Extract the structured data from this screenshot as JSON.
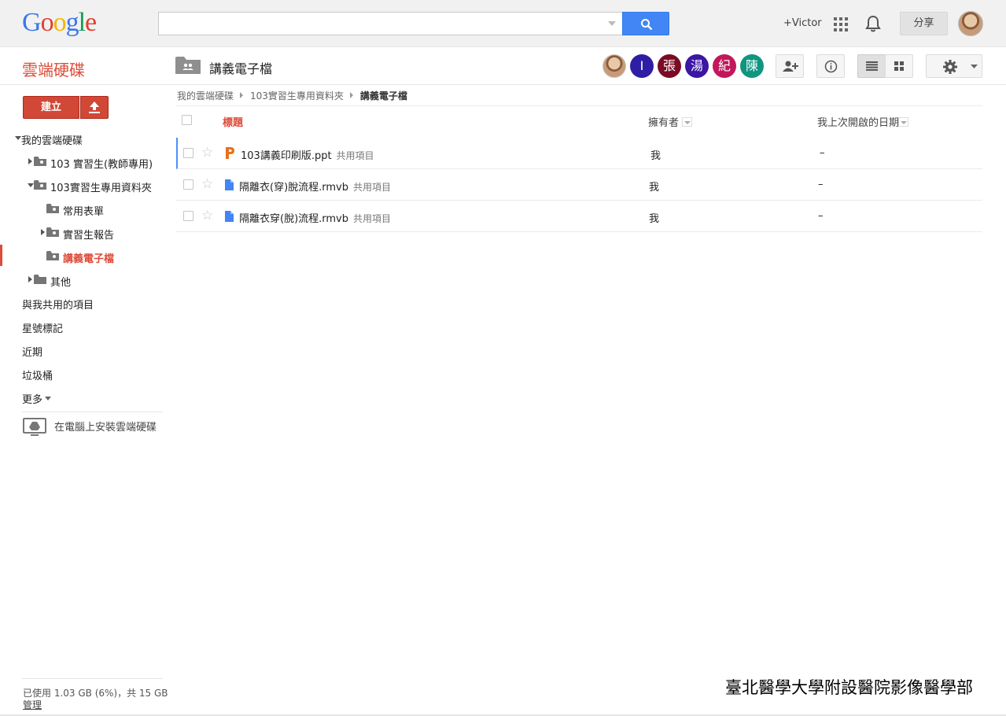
{
  "header": {
    "logo_text": "Google",
    "search": {
      "placeholder": "",
      "value": ""
    },
    "user_link": "+Victor",
    "share_label": "分享"
  },
  "subheader": {
    "app_name": "雲端硬碟",
    "folder_title": "講義電子檔",
    "shared_with": [
      "I",
      "張",
      "湯",
      "紀",
      "陳"
    ]
  },
  "sidebar": {
    "create_label": "建立",
    "tree": {
      "root": "我的雲端硬碟",
      "items": [
        {
          "label": "103 實習生(教師專用)"
        },
        {
          "label": "103實習生專用資料夾"
        },
        {
          "label": "常用表單"
        },
        {
          "label": "實習生報告"
        },
        {
          "label": "講義電子檔"
        },
        {
          "label": "其他"
        }
      ]
    },
    "links": [
      "與我共用的項目",
      "星號標記",
      "近期",
      "垃圾桶",
      "更多"
    ],
    "install_label": "在電腦上安裝雲端硬碟",
    "storage_text": "已使用 1.03 GB (6%)，共 15 GB",
    "manage_label": "管理"
  },
  "breadcrumb": [
    "我的雲端硬碟",
    "103實習生專用資料夾",
    "講義電子檔"
  ],
  "columns": {
    "title": "標題",
    "owner": "擁有者",
    "last_opened": "我上次開啟的日期"
  },
  "files": [
    {
      "name": "103講義印刷版.ppt",
      "shared": "共用項目",
      "owner": "我",
      "last_opened": "–",
      "type": "ppt"
    },
    {
      "name": "隔離衣(穿)脫流程.rmvb",
      "shared": "共用項目",
      "owner": "我",
      "last_opened": "–",
      "type": "file"
    },
    {
      "name": "隔離衣穿(脫)流程.rmvb",
      "shared": "共用項目",
      "owner": "我",
      "last_opened": "–",
      "type": "file"
    }
  ],
  "watermark": "臺北醫學大學附設醫院影像醫學部",
  "colors": {
    "accent": "#dd4b39",
    "search_blue": "#4285f4"
  }
}
